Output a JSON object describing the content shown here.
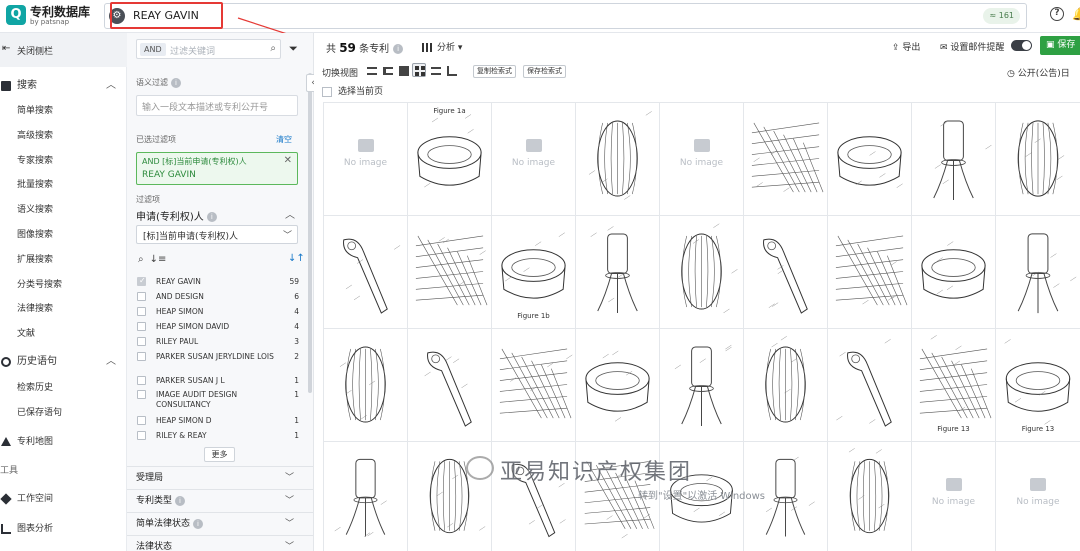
{
  "logo": {
    "title": "专利数据库",
    "subtitle": "by patsnap",
    "glyph": "Q"
  },
  "search": {
    "query": "REAY GAVIN",
    "count_badge": "≈ 161"
  },
  "leftnav": {
    "collapse_label": "关闭侧栏",
    "search_section": "搜索",
    "search_items": [
      "简单搜索",
      "高级搜索",
      "专家搜索",
      "批量搜索",
      "语义搜索",
      "图像搜索",
      "扩展搜索",
      "分类号搜索",
      "法律搜索",
      "文献"
    ],
    "history_section": "历史语句",
    "history_items": [
      "检索历史",
      "已保存语句"
    ],
    "map_label": "专利地图",
    "tools_label": "工具",
    "workspace_label": "工作空间",
    "chart_label": "图表分析"
  },
  "filter": {
    "and_label": "AND",
    "keyword_placeholder": "过滤关键词",
    "semantic_label": "语义过滤",
    "semantic_placeholder": "输入一段文本描述或专利公开号",
    "selected_label": "已选过滤项",
    "clear_label": "清空",
    "chip_line1": "AND  [标]当前申请(专利权)人",
    "chip_line2": "REAY GAVIN",
    "filter_items_label": "过滤项",
    "applicant_header": "申请(专利权)人",
    "applicant_select": "[标]当前申请(专利权)人",
    "applicants": [
      {
        "name": "REAY GAVIN",
        "count": "59",
        "checked": true
      },
      {
        "name": "AND DESIGN",
        "count": "6",
        "checked": false
      },
      {
        "name": "HEAP SIMON",
        "count": "4",
        "checked": false
      },
      {
        "name": "HEAP SIMON DAVID",
        "count": "4",
        "checked": false
      },
      {
        "name": "RILEY PAUL",
        "count": "3",
        "checked": false
      },
      {
        "name": "PARKER SUSAN JERYLDINE LOIS",
        "count": "2",
        "checked": false
      },
      {
        "name": "PARKER SUSAN J L",
        "count": "1",
        "checked": false
      },
      {
        "name": "IMAGE AUDIT DESIGN CONSULTANCY",
        "count": "1",
        "checked": false
      },
      {
        "name": "HEAP SIMON D",
        "count": "1",
        "checked": false
      },
      {
        "name": "RILEY & REAY",
        "count": "1",
        "checked": false
      }
    ],
    "more_label": "更多",
    "groups": [
      "受理局",
      "专利类型",
      "简单法律状态",
      "法律状态"
    ]
  },
  "main": {
    "summary_prefix": "共",
    "summary_count": "59",
    "summary_suffix": "条专利",
    "analysis_label": "分析",
    "export_label": "导出",
    "mail_label": "设置邮件提醒",
    "save_label": "保存",
    "view_label": "切换视图",
    "copy_query_label": "复制检索式",
    "save_query_label": "保存检索式",
    "sort_label": "公开(公告)日",
    "select_all_label": "选择当前页",
    "no_image_label": "No image",
    "cells": [
      "noimg",
      "drawing",
      "noimg",
      "drawing",
      "noimg",
      "drawing",
      "drawing",
      "drawing",
      "drawing",
      "drawing",
      "drawing",
      "drawing",
      "drawing",
      "drawing",
      "drawing",
      "drawing",
      "drawing",
      "drawing",
      "drawing",
      "drawing",
      "drawing",
      "drawing",
      "drawing",
      "drawing",
      "drawing",
      "drawing",
      "drawing",
      "drawing",
      "drawing",
      "drawing",
      "drawing",
      "drawing",
      "drawing",
      "drawing",
      "noimg",
      "noimg"
    ],
    "figure_labels": {
      "r1c2": "Figure 1a",
      "r2c3": "Figure 1b",
      "r3c8": "Figure 13",
      "r3c9": "Figure 13"
    }
  },
  "watermark": {
    "text": "亚易知识产权集团",
    "activate": "转到\"设置\"以激活 Windows"
  },
  "colors": {
    "save_green": "#2ea043",
    "accent_blue": "#1677c8",
    "highlight_red": "#e53935",
    "chip_green": "#5cb85c"
  }
}
